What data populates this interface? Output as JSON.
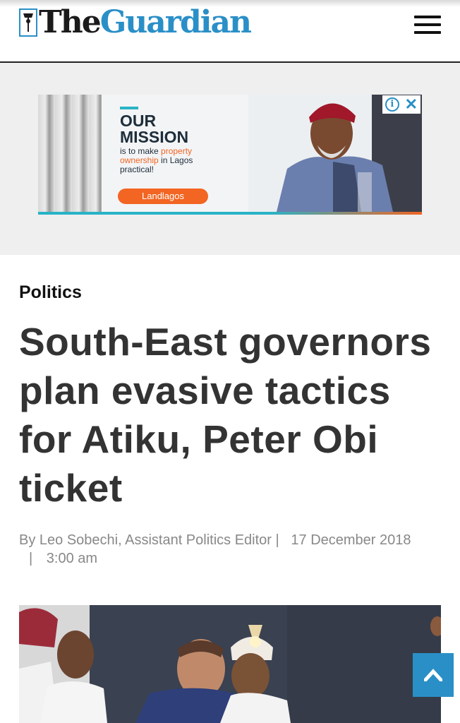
{
  "header": {
    "logo_the": "The",
    "logo_guardian": "Guardian",
    "menu_icon": "hamburger-menu-icon",
    "brand_color": "#2a8fc7"
  },
  "ad": {
    "headline_line1": "OUR",
    "headline_line2": "MISSION",
    "sub_pre": "is to make ",
    "sub_highlight": "property ownership",
    "sub_post": " in Lagos practical!",
    "cta": "Landlagos",
    "info_icon": "info-icon",
    "close_icon": "close-icon",
    "accent_color": "#f26522"
  },
  "article": {
    "section": "Politics",
    "title": "South-East governors plan evasive tactics for Atiku, Peter Obi ticket",
    "byline": {
      "author": "By Leo Sobechi, Assistant Politics Editor",
      "separator": "|",
      "date": "17 December 2018",
      "time": "3:00 am"
    }
  },
  "back_to_top": {
    "icon": "chevron-up-icon"
  }
}
